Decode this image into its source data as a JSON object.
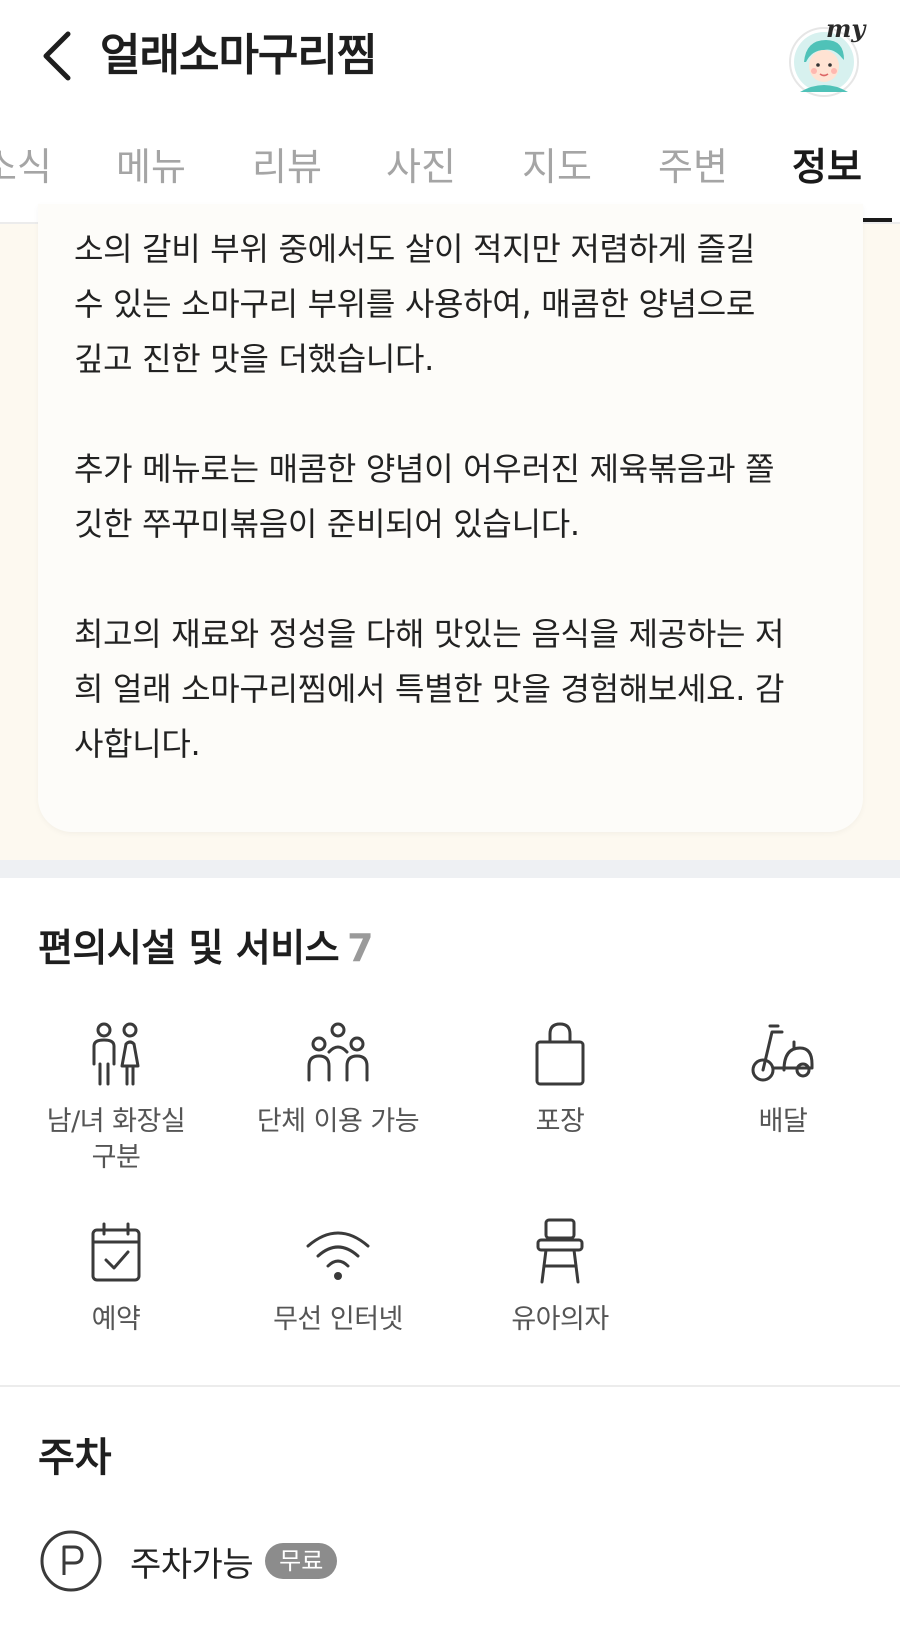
{
  "header": {
    "title": "얼래소마구리찜",
    "my_label": "my"
  },
  "tabs": [
    {
      "label": "소식"
    },
    {
      "label": "메뉴"
    },
    {
      "label": "리뷰"
    },
    {
      "label": "사진"
    },
    {
      "label": "지도"
    },
    {
      "label": "주변"
    },
    {
      "label": "정보",
      "active": true
    }
  ],
  "description": {
    "text": "소의 갈비 부위 중에서도 살이 적지만 저렴하게 즐길\n수 있는 소마구리 부위를 사용하여, 매콤한 양념으로\n깊고 진한 맛을 더했습니다.\n\n추가 메뉴로는 매콤한 양념이 어우러진 제육볶음과 쫄\n깃한 쭈꾸미볶음이 준비되어 있습니다.\n\n최고의 재료와 정성을 다해 맛있는 음식을 제공하는 저\n희 얼래 소마구리찜에서 특별한 맛을 경험해보세요. 감\n사합니다."
  },
  "facilities": {
    "title": "편의시설 및 서비스",
    "count": "7",
    "items": [
      {
        "label": "남/녀 화장실\n구분",
        "icon": "restroom-icon"
      },
      {
        "label": "단체 이용 가능",
        "icon": "group-icon"
      },
      {
        "label": "포장",
        "icon": "shopping-bag-icon"
      },
      {
        "label": "배달",
        "icon": "scooter-icon"
      },
      {
        "label": "예약",
        "icon": "calendar-check-icon"
      },
      {
        "label": "무선 인터넷",
        "icon": "wifi-icon"
      },
      {
        "label": "유아의자",
        "icon": "high-chair-icon"
      }
    ]
  },
  "parking": {
    "title": "주차",
    "status": "주차가능",
    "badge": "무료",
    "icon": "parking-icon"
  }
}
